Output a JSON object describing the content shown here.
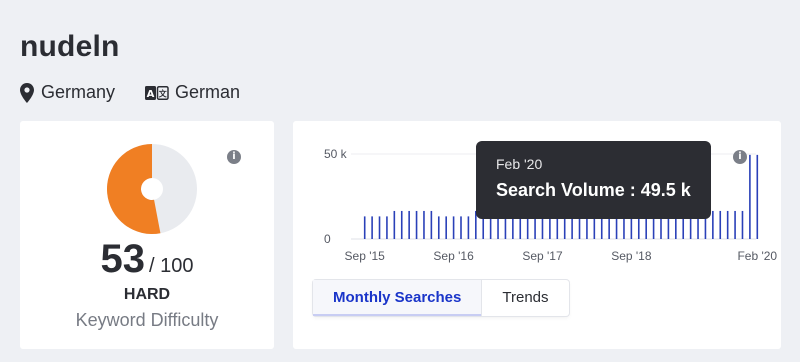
{
  "keyword": "nudeln",
  "meta": {
    "location": "Germany",
    "location_icon": "map-pin-icon",
    "language": "German",
    "language_icon": "translate-icon"
  },
  "difficulty": {
    "score": "53",
    "max": "/ 100",
    "level": "HARD",
    "label": "Keyword Difficulty",
    "score_value": 53,
    "colors": {
      "filled": "#f07f23",
      "empty": "#e9ebef"
    }
  },
  "volume": {
    "tooltip_date": "Feb '20",
    "tooltip_value": "Search Volume : 49.5 k",
    "tabs": [
      "Monthly Searches",
      "Trends"
    ],
    "active_tab": "Monthly Searches",
    "accent_color": "#1a35c9"
  },
  "chart_data": {
    "type": "bar",
    "ylim": [
      0,
      50000
    ],
    "y_tick_labels": [
      "0",
      "50 k"
    ],
    "x_tick_labels": [
      "Sep '15",
      "Sep '16",
      "Sep '17",
      "Sep '18",
      "Feb '20"
    ],
    "x_tick_positions": [
      0,
      12,
      24,
      36,
      53
    ],
    "values": [
      13300,
      13300,
      13300,
      13300,
      16500,
      16500,
      16500,
      16500,
      16500,
      16500,
      13300,
      13300,
      13300,
      13300,
      13300,
      16500,
      16500,
      16500,
      16500,
      16500,
      16500,
      16500,
      16500,
      16500,
      16500,
      16500,
      16500,
      16500,
      16500,
      16500,
      16500,
      16500,
      16500,
      16500,
      16500,
      16500,
      16500,
      16500,
      16500,
      16500,
      16500,
      16500,
      16500,
      16500,
      16500,
      16500,
      16500,
      16500,
      16500,
      16500,
      16500,
      16500,
      49500,
      49500
    ],
    "series_color": "#2a40b8",
    "grid": true
  }
}
